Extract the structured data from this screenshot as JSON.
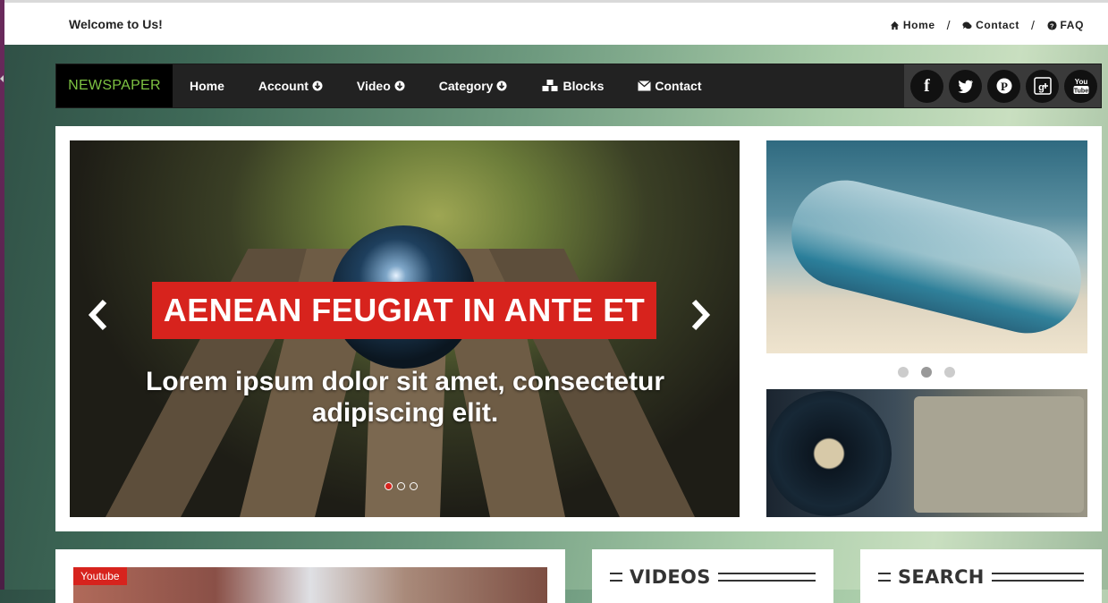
{
  "topbar": {
    "welcome": "Welcome to Us!",
    "links": [
      {
        "label": "Home",
        "icon": "home-icon"
      },
      {
        "label": "Contact",
        "icon": "comments-icon"
      },
      {
        "label": "FAQ",
        "icon": "question-circle-icon"
      }
    ]
  },
  "nav": {
    "brand": "NEWSPAPER",
    "items": [
      {
        "label": "Home"
      },
      {
        "label": "Account",
        "icon": "arrow-circle-down-icon"
      },
      {
        "label": "Video",
        "icon": "arrow-circle-down-icon"
      },
      {
        "label": "Category",
        "icon": "arrow-circle-down-icon"
      },
      {
        "label": "Blocks",
        "icon": "cubes-icon"
      },
      {
        "label": "Contact",
        "icon": "envelope-icon"
      }
    ],
    "social": [
      {
        "name": "facebook-icon",
        "glyph": "f"
      },
      {
        "name": "twitter-icon",
        "glyph": "t"
      },
      {
        "name": "pinterest-icon",
        "glyph": "P"
      },
      {
        "name": "google-plus-icon",
        "glyph": "g+"
      },
      {
        "name": "youtube-icon",
        "glyph": "You Tube"
      }
    ]
  },
  "slider": {
    "title": "AENEAN FEUGIAT IN ANTE ET",
    "subtitle": "Lorem ipsum dolor sit amet, consectetur adipiscing elit.",
    "dots": 3,
    "active_dot": 0
  },
  "side_slider": {
    "dots": 3,
    "active_dot": 1
  },
  "bottom": {
    "youtube_badge": "Youtube",
    "videos_title": "VIDEOS",
    "search_title": "SEARCH"
  },
  "colors": {
    "accent_red": "#d7231d",
    "brand_green": "#7dc242",
    "nav_bg": "#222222"
  }
}
